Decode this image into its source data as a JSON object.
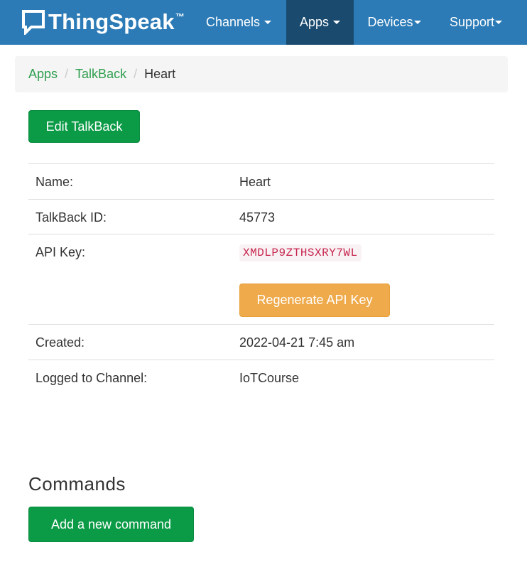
{
  "brand": {
    "name": "ThingSpeak",
    "tm": "™",
    "icon": "chat-bubble-icon"
  },
  "nav": {
    "items": [
      {
        "label": "Channels",
        "active": false
      },
      {
        "label": "Apps",
        "active": true
      },
      {
        "label": "Devices",
        "active": false
      },
      {
        "label": "Support",
        "active": false
      }
    ]
  },
  "breadcrumb": {
    "items": [
      "Apps",
      "TalkBack"
    ],
    "current": "Heart"
  },
  "edit_button": "Edit TalkBack",
  "details": {
    "name_label": "Name:",
    "name_value": "Heart",
    "id_label": "TalkBack ID:",
    "id_value": "45773",
    "api_key_label": "API Key:",
    "api_key_value": "XMDLP9ZTHSXRY7WL",
    "regenerate_button": "Regenerate API Key",
    "created_label": "Created:",
    "created_value": "2022-04-21 7:45 am",
    "channel_label": "Logged to Channel:",
    "channel_value": "IoTCourse"
  },
  "commands": {
    "title": "Commands",
    "add_button": "Add a new command"
  },
  "colors": {
    "navbar": "#2c7bb6",
    "nav_active": "#1a4a6e",
    "link_green": "#2e9e4e",
    "button_green": "#0b9a46",
    "button_orange": "#efaa4b",
    "code_text": "#c7254e"
  }
}
